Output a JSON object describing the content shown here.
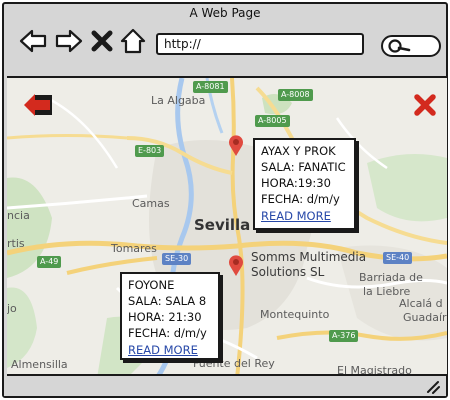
{
  "window": {
    "title": "A Web Page"
  },
  "toolbar": {
    "back_icon": "arrow-left-icon",
    "forward_icon": "arrow-right-icon",
    "stop_icon": "close-x-icon",
    "home_icon": "home-icon",
    "address_value": "http://",
    "search_icon": "search-icon"
  },
  "map": {
    "labels": {
      "la_algaba": "La Algaba",
      "camas": "Camas",
      "tomares": "Tomares",
      "sevilla": "Sevilla",
      "montequinto": "Montequinto",
      "barriada": "Barriada de",
      "la_liebre": "la Liebre",
      "alcala_1": "Alcalá d",
      "alcala_2": "Guadaír",
      "almensilla": "Almensilla",
      "fuente_del_rey": "Fuente del Rey",
      "el_magistrado": "El Magistrado",
      "ncia": "ncia",
      "rtis": "rtis",
      "jo": "jo",
      "poi_line1": "Somms Multimedia",
      "poi_line2": "Solutions SL"
    },
    "roads": {
      "a8081": "A-8081",
      "a8008": "A-8008",
      "a8005": "A-8005",
      "e803": "E-803",
      "se30": "SE-30",
      "a49": "A-49",
      "se40": "SE-40",
      "a376": "A-376"
    }
  },
  "events": [
    {
      "name": "AYAX Y PROK",
      "room": "SALA: FANATIC",
      "time": "HORA:19:30",
      "date": "FECHA: d/m/y",
      "link": "READ MORE"
    },
    {
      "name": "FOYONE",
      "room": "SALA: SALA 8",
      "time": "HORA: 21:30",
      "date": "FECHA: d/m/y",
      "link": "READ MORE"
    }
  ],
  "controls": {
    "back_icon": "red-arrow-left-icon",
    "close_icon": "red-x-icon",
    "resize_icon": "resize-grip-icon"
  },
  "colors": {
    "accent_red": "#d32a1e",
    "link_blue": "#2748a8",
    "road_green": "#4f9a4d",
    "road_blue": "#5d82c4",
    "highway_yellow": "#f4d27a",
    "pin_red": "#e04a3f"
  }
}
